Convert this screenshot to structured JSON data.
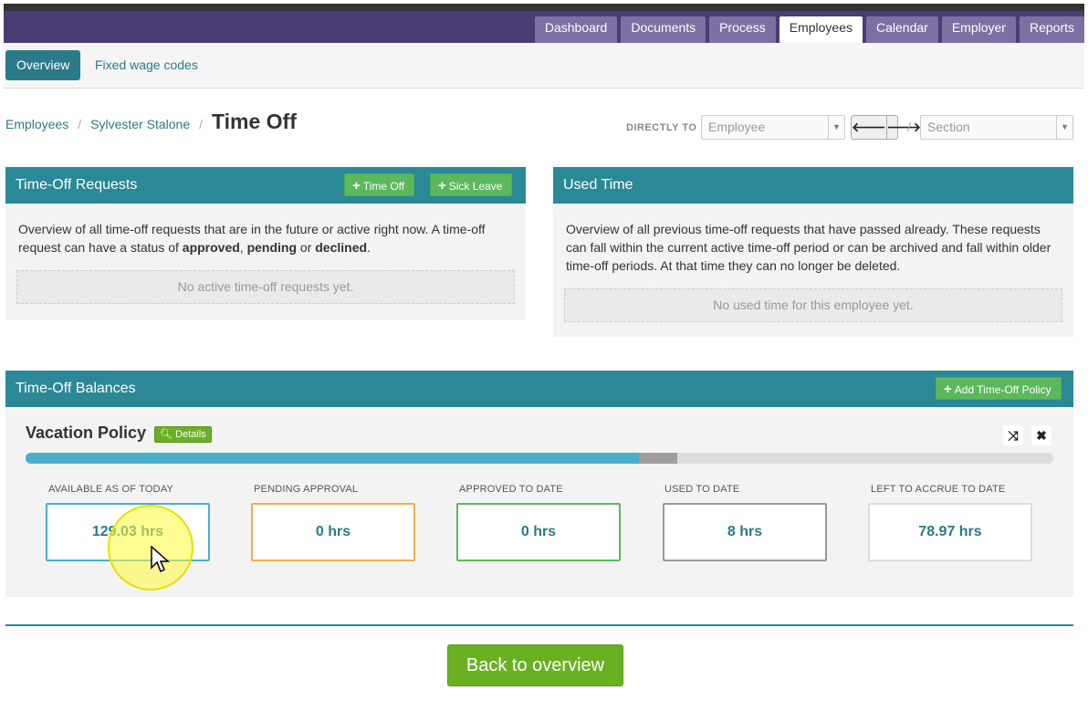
{
  "topnav": {
    "tabs": [
      "Dashboard",
      "Documents",
      "Process",
      "Employees",
      "Calendar",
      "Employer",
      "Reports"
    ],
    "active": "Employees"
  },
  "subnav": {
    "overview": "Overview",
    "fixed_wage_codes": "Fixed wage codes"
  },
  "breadcrumb": {
    "employees": "Employees",
    "employee": "Sylvester Stalone",
    "current": "Time Off",
    "sep": "/"
  },
  "directly_to": {
    "label": "DIRECTLY TO",
    "employee_placeholder": "Employee",
    "section_placeholder": "Section",
    "prev_icon": "arrow-left-icon",
    "next_icon": "arrow-right-icon"
  },
  "requests_panel": {
    "title": "Time-Off Requests",
    "btn_time_off": "Time Off",
    "btn_sick_leave": "Sick Leave",
    "desc_start": "Overview of all time-off requests that are in the future or active right now. A time-off request can have a status of ",
    "status_approved": "approved",
    "comma": ", ",
    "status_pending": "pending",
    "or": " or ",
    "status_declined": "declined",
    "period": ".",
    "empty": "No active time-off requests yet."
  },
  "used_panel": {
    "title": "Used Time",
    "desc": "Overview of all previous time-off requests that have passed already. These requests can fall within the current active time-off period or can be archived and fall within older time-off periods. At that time they can no longer be deleted.",
    "empty": "No used time for this employee yet."
  },
  "balances_panel": {
    "title": "Time-Off Balances",
    "add_policy": "Add Time-Off Policy",
    "policy": {
      "name": "Vacation Policy",
      "details": "Details",
      "progress": {
        "available_fraction": 0.597,
        "used_fraction": 0.037
      },
      "stats": [
        {
          "label": "AVAILABLE AS OF TODAY",
          "value": "129.03 hrs",
          "color": "#46b0cd"
        },
        {
          "label": "PENDING APPROVAL",
          "value": "0 hrs",
          "color": "#f0ad4e"
        },
        {
          "label": "APPROVED TO DATE",
          "value": "0 hrs",
          "color": "#5cb85c"
        },
        {
          "label": "USED TO DATE",
          "value": "8 hrs",
          "color": "#999999"
        },
        {
          "label": "LEFT TO ACCRUE TO DATE",
          "value": "78.97 hrs",
          "color": "#dddddd"
        }
      ]
    }
  },
  "back_button": "Back to overview",
  "colors": {
    "header": "#4a3d75",
    "teal": "#2b8896",
    "green": "#6ab023"
  }
}
